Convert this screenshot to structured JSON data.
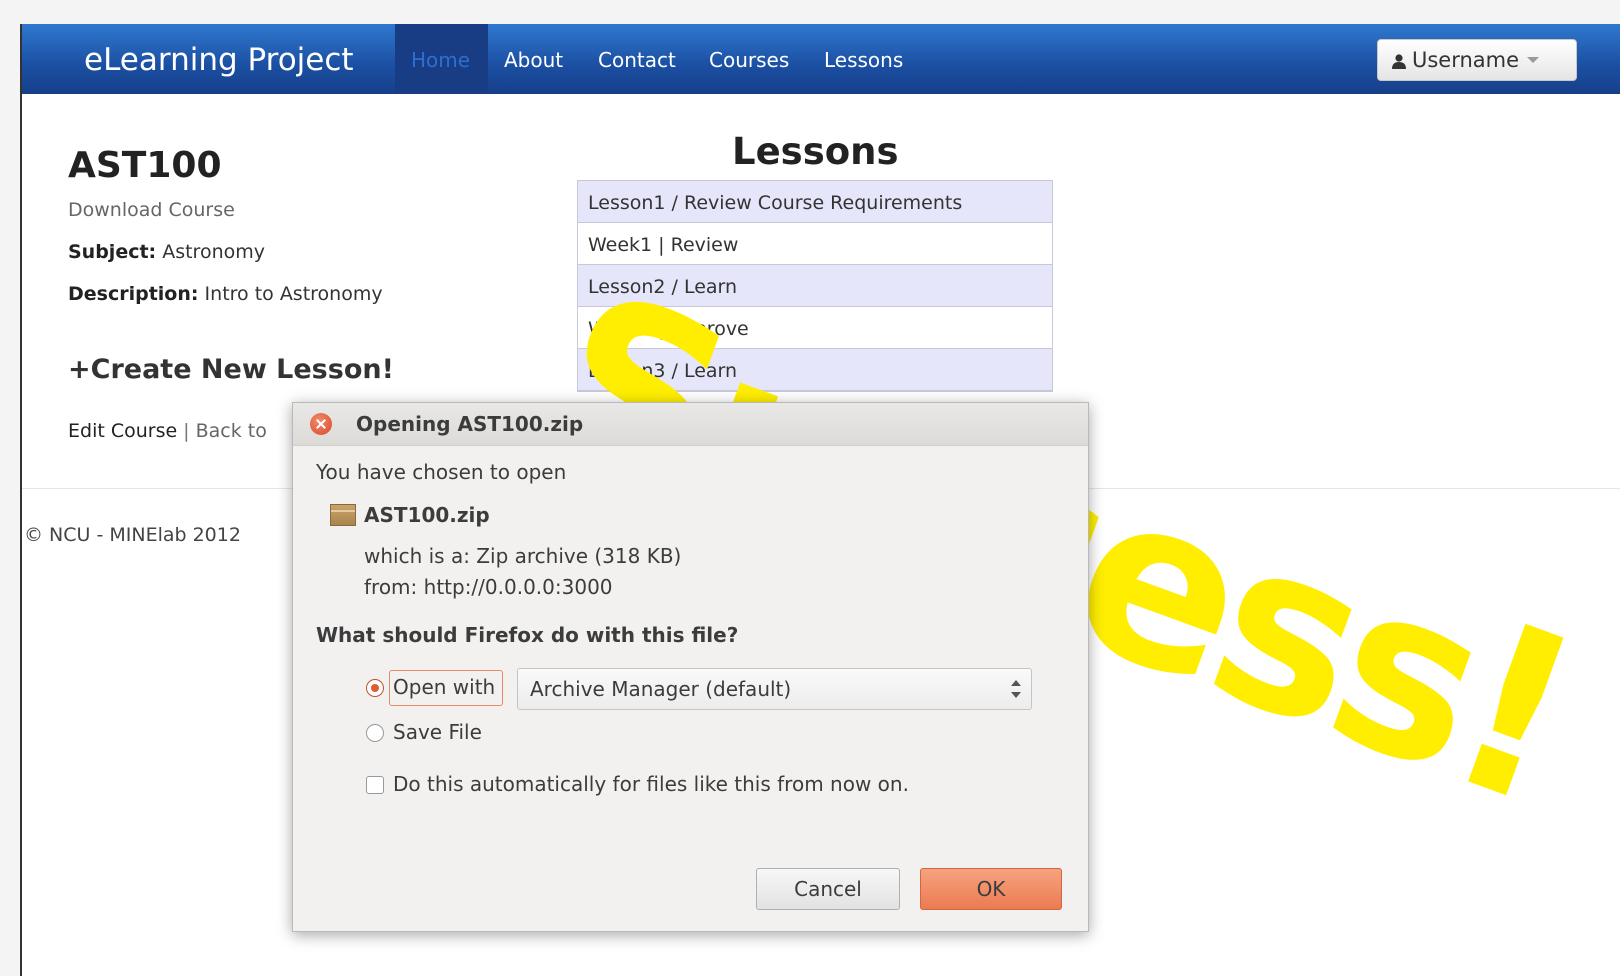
{
  "navbar": {
    "brand": "eLearning Project",
    "items": [
      {
        "label": "Home",
        "active": true
      },
      {
        "label": "About"
      },
      {
        "label": "Contact"
      },
      {
        "label": "Courses"
      },
      {
        "label": "Lessons"
      }
    ],
    "user_label": "Username"
  },
  "course": {
    "title": "AST100",
    "download_label": "Download Course",
    "subject_key": "Subject:",
    "subject_value": "Astronomy",
    "description_key": "Description:",
    "description_value": "Intro to Astronomy",
    "create_label": "+Create New Lesson!",
    "edit_label": "Edit Course",
    "separator": "|",
    "back_label": "Back to"
  },
  "footer": {
    "text": "© NCU - MINElab 2012"
  },
  "lessons": {
    "heading": "Lessons",
    "rows": [
      "Lesson1 / Review Course Requirements",
      "Week1 | Review",
      "Lesson2 / Learn",
      "Week2 | Improve",
      "Lesson3 / Learn"
    ]
  },
  "overlay": {
    "text": "Success!",
    "color": "#ffee00"
  },
  "dialog": {
    "title": "Opening AST100.zip",
    "intro": "You have chosen to open",
    "filename": "AST100.zip",
    "type_line": "which is a:  Zip archive (318 KB)",
    "from_line": "from:  http://0.0.0.0:3000",
    "question": "What should Firefox do with this file?",
    "open_with_label": "Open with",
    "open_with_app": "Archive Manager (default)",
    "save_file_label": "Save File",
    "auto_label": "Do this automatically for files like this from now on.",
    "cancel_label": "Cancel",
    "ok_label": "OK",
    "selected_option": "Open with"
  }
}
